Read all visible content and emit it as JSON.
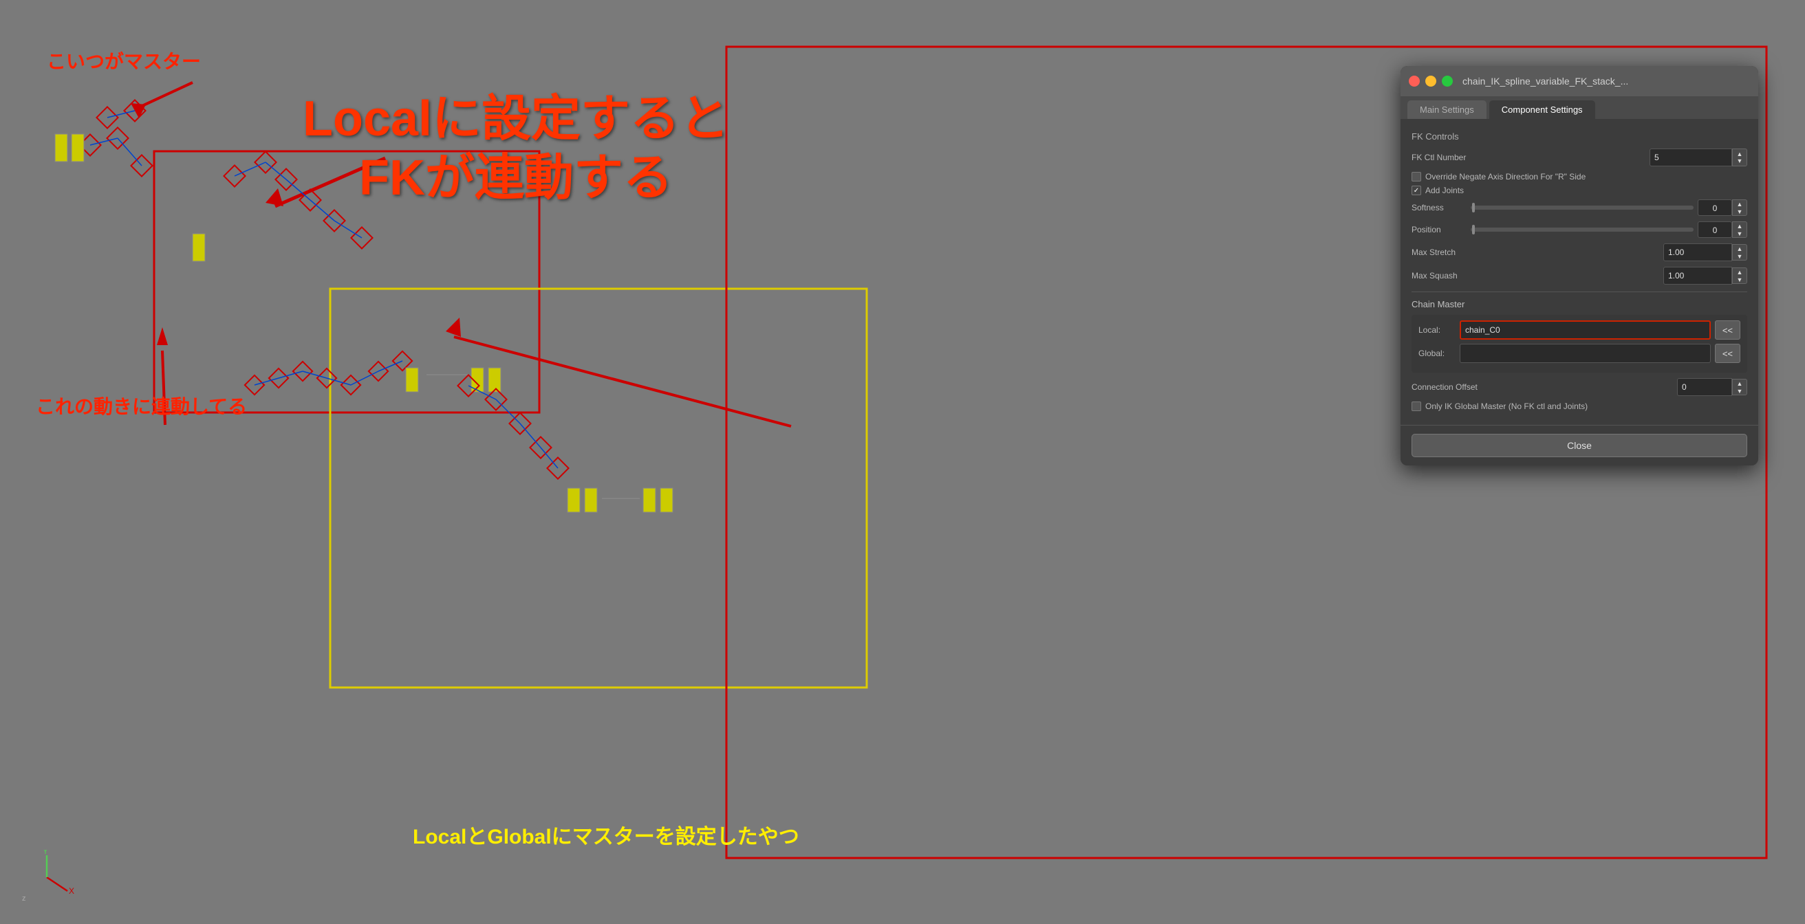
{
  "viewport": {
    "background": "#7a7a7a"
  },
  "annotations": {
    "master": "こいつがマスター",
    "rendo": "これの動きに連動してる",
    "center_line1": "Localに設定すると",
    "center_line2": "FKが連動する",
    "bottom": "LocalとGlobalにマスターを設定したやつ"
  },
  "panel": {
    "title": "chain_IK_spline_variable_FK_stack_...",
    "tab_main": "Main Settings",
    "tab_component": "Component Settings",
    "sections": {
      "fk_controls": "FK Controls",
      "fk_ctl_number_label": "FK Ctl Number",
      "fk_ctl_number_value": "5",
      "override_label": "Override Negate Axis Direction For \"R\" Side",
      "override_checked": false,
      "add_joints_label": "Add Joints",
      "add_joints_checked": true,
      "softness_label": "Softness",
      "softness_value": "0",
      "position_label": "Position",
      "position_value": "0",
      "max_stretch_label": "Max Stretch",
      "max_stretch_value": "1.00",
      "max_squash_label": "Max Squash",
      "max_squash_value": "1.00",
      "chain_master_label": "Chain Master",
      "local_label": "Local:",
      "local_value": "chain_C0",
      "local_arrow": "<<",
      "global_label": "Global:",
      "global_value": "",
      "global_arrow": "<<",
      "connection_offset_label": "Connection Offset",
      "connection_offset_value": "0",
      "only_ik_label": "Only IK Global Master (No FK ctl and Joints)",
      "only_ik_checked": false
    },
    "close_button": "Close"
  }
}
